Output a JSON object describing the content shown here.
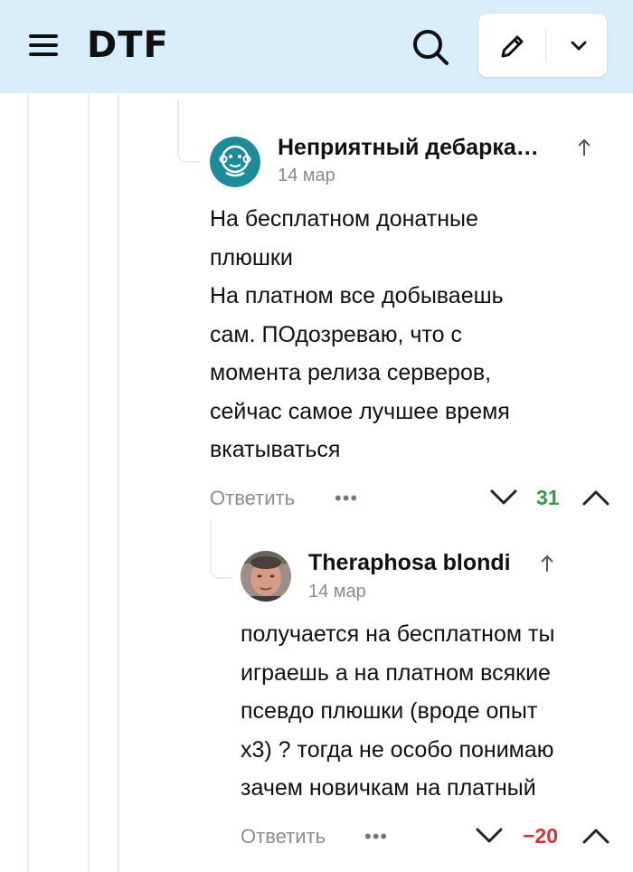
{
  "header": {
    "logo": "DTF",
    "menu_icon": "burger-menu-icon",
    "search_icon": "search-icon",
    "write_icon": "pencil-icon",
    "dropdown_icon": "chevron-down-icon",
    "background": "#d8eefa"
  },
  "comments": [
    {
      "author": "Неприятный дебарка…",
      "date": "14 мар",
      "text_lines": [
        "На бесплатном донатные",
        "плюшки",
        "На платном все добываешь",
        "сам. ПОдозреваю, что с",
        "момента релиза серверов,",
        "сейчас самое лучшее время",
        "вкатываться"
      ],
      "reply_label": "Ответить",
      "more_label": "•••",
      "rating": "31",
      "rating_color": "#2ea043",
      "avatar_color": "#1d8b9a"
    },
    {
      "author": "Theraphosa blondi",
      "date": "14 мар",
      "text_lines": [
        "получается на бесплатном ты",
        "играешь а на платном всякие",
        "псевдо плюшки (вроде опыт",
        "х3) ? тогда не особо понимаю",
        "зачем новичкам на платный"
      ],
      "reply_label": "Ответить",
      "more_label": "•••",
      "rating": "−20",
      "rating_color": "#d0343b"
    }
  ]
}
